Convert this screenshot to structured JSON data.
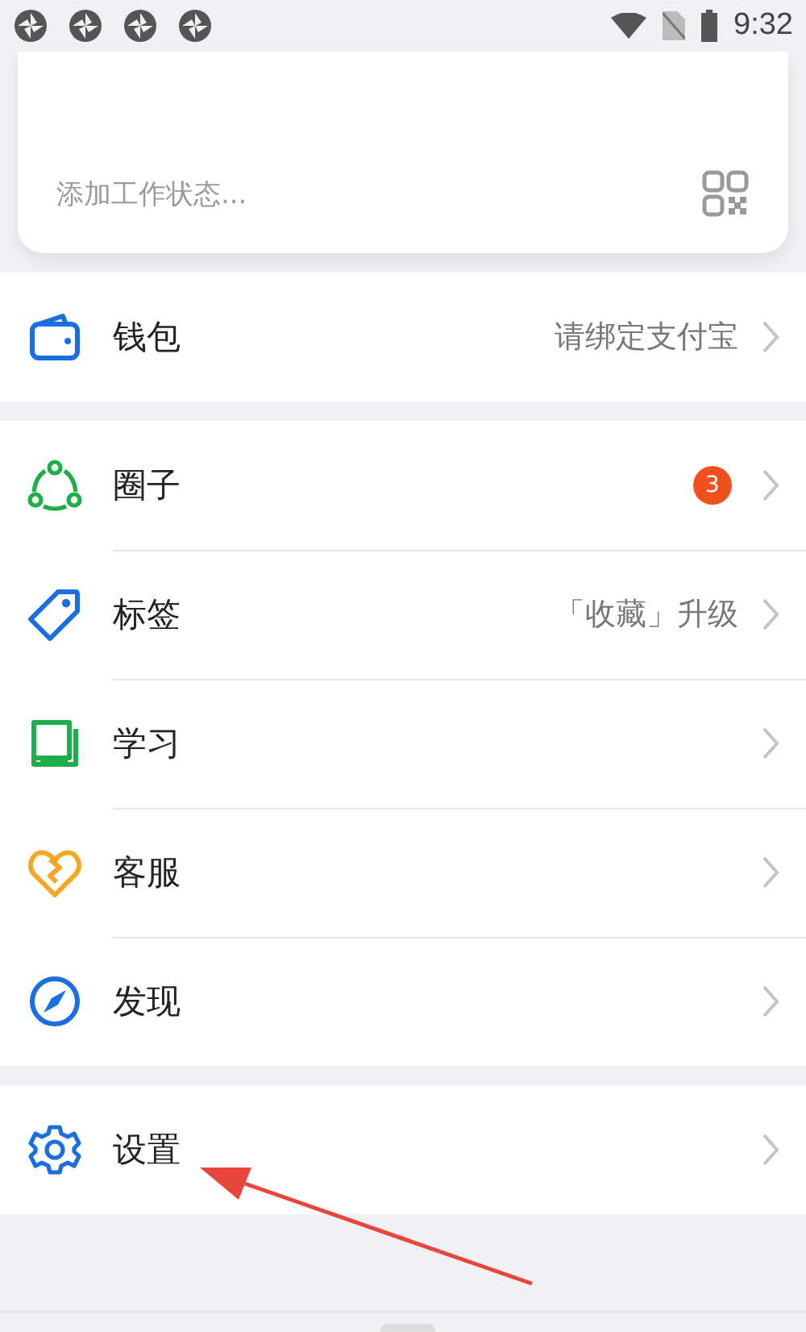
{
  "status_bar": {
    "time": "9:32"
  },
  "profile_card": {
    "placeholder": "添加工作状态..."
  },
  "groups": [
    {
      "items": [
        {
          "kind": "wallet",
          "label": "钱包",
          "detail": "请绑定支付宝"
        }
      ]
    },
    {
      "items": [
        {
          "kind": "circle",
          "label": "圈子",
          "badge": "3"
        },
        {
          "kind": "tag",
          "label": "标签",
          "detail": "「收藏」升级"
        },
        {
          "kind": "book",
          "label": "学习"
        },
        {
          "kind": "heart",
          "label": "客服"
        },
        {
          "kind": "compass",
          "label": "发现"
        }
      ]
    },
    {
      "items": [
        {
          "kind": "gear",
          "label": "设置"
        }
      ]
    }
  ]
}
